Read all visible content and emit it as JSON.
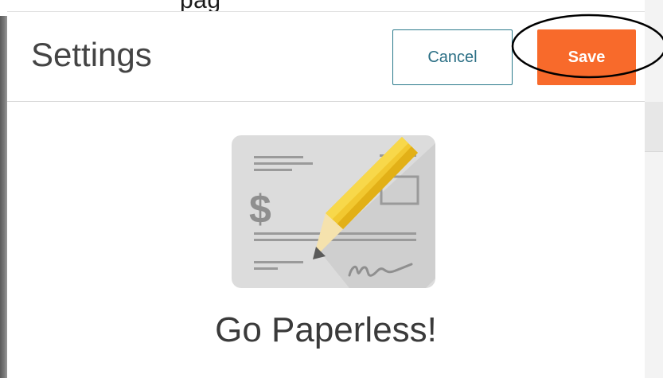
{
  "header": {
    "title": "Settings",
    "cancel_label": "Cancel",
    "save_label": "Save"
  },
  "promo": {
    "title": "Go Paperless!",
    "icon": "paper-check-pencil-icon"
  },
  "colors": {
    "accent_save": "#f86a2b",
    "cancel_border": "#2b7a8c",
    "annotation_outline": "#000000"
  }
}
